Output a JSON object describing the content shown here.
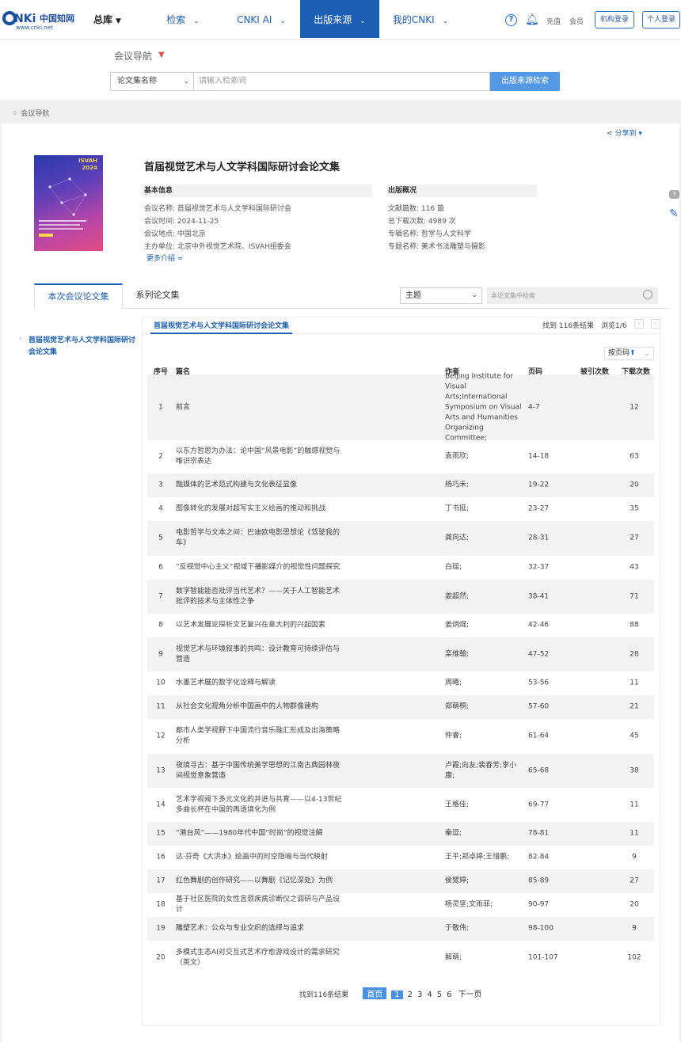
{
  "header": {
    "logo_text": "CNKi中国知网",
    "logo_url": "www.cnki.net",
    "nav": {
      "zongku": "总库",
      "search": "检索",
      "ai": "CNKI AI",
      "source": "出版来源",
      "mycnki": "我的CNKI"
    },
    "recharge": "充值",
    "member": "会员",
    "org_login": "机构登录",
    "personal_login": "个人登录"
  },
  "search": {
    "nav_label": "会议导航",
    "field": "论文集名称",
    "placeholder": "请输入检索词",
    "button": "出版来源检索"
  },
  "breadcrumb": "会议导航",
  "share": "分享到",
  "book": {
    "cover_title": "ISVAH",
    "cover_year": "2024",
    "title": "首届视觉艺术与人文学科国际研讨会论文集",
    "basic_head": "基本信息",
    "basic": [
      {
        "label": "会议名称:",
        "value": "首届视觉艺术与人文学科国际研讨会"
      },
      {
        "label": "会议时间:",
        "value": "2024-11-25"
      },
      {
        "label": "会议地点:",
        "value": "中国北京"
      },
      {
        "label": "主办单位:",
        "value": "北京中外视觉艺术院、ISVAH组委会"
      }
    ],
    "more": "更多介绍",
    "pub_head": "出版概况",
    "pub": [
      {
        "label": "文献篇数:",
        "value": "116 篇"
      },
      {
        "label": "总下载次数:",
        "value": "4989 次"
      },
      {
        "label": "专辑名称:",
        "value": "哲学与人文科学"
      },
      {
        "label": "专题名称:",
        "value": "美术书法雕塑与摄影"
      }
    ]
  },
  "tabs": {
    "current": "本次会议论文集",
    "series": "系列论文集",
    "theme_select": "主题",
    "inner_placeholder": "本论文集中检索"
  },
  "sidebar": {
    "item": "首届视觉艺术与人文学科国际研讨会论文集"
  },
  "list": {
    "sub_tab": "首届视觉艺术与人文学科国际研讨会论文集",
    "found": "找到 116条结果",
    "browse": "浏览1/6",
    "sort": "按页码",
    "headers": {
      "no": "序号",
      "title": "篇名",
      "author": "作者",
      "pages": "页码",
      "cite": "被引次数",
      "download": "下载次数"
    },
    "rows": [
      {
        "no": "1",
        "title": "前言",
        "author": "Beijing Institute for Visual Arts;International Symposium on Visual Arts and Humanities Organizing Committee;",
        "pages": "4-7",
        "cite": "",
        "dl": "12"
      },
      {
        "no": "2",
        "title": "以东方哲思为办法：论中国“风景电影”的触感视觉与唯识宗表达",
        "author": "袁雨欣;",
        "pages": "14-18",
        "cite": "",
        "dl": "63"
      },
      {
        "no": "3",
        "title": "融媒体的艺术范式构建与文化表征显像",
        "author": "杨巧禾;",
        "pages": "19-22",
        "cite": "",
        "dl": "20"
      },
      {
        "no": "4",
        "title": "图像转化的发展对超写实主义绘画的推动和挑战",
        "author": "丁书挺;",
        "pages": "23-27",
        "cite": "",
        "dl": "35"
      },
      {
        "no": "5",
        "title": "电影哲学与文本之间：巴迪欧电影思想论《驾驶我的车》",
        "author": "龚向达;",
        "pages": "28-31",
        "cite": "",
        "dl": "27"
      },
      {
        "no": "6",
        "title": "“反视觉中心主义”视域下播影媒介的视觉性问题探究",
        "author": "白瑶;",
        "pages": "32-37",
        "cite": "",
        "dl": "43"
      },
      {
        "no": "7",
        "title": "数字智能能否批评当代艺术？——关于人工智能艺术批评的技术与主体性之争",
        "author": "姜超然;",
        "pages": "38-41",
        "cite": "",
        "dl": "71"
      },
      {
        "no": "8",
        "title": "以艺术发展论探析文艺复兴在意大利的兴起因素",
        "author": "姜炳焜;",
        "pages": "42-46",
        "cite": "",
        "dl": "88"
      },
      {
        "no": "9",
        "title": "视觉艺术与环境叙事的共鸣：设计教育可持续评估与营造",
        "author": "栾维翰;",
        "pages": "47-52",
        "cite": "",
        "dl": "28"
      },
      {
        "no": "10",
        "title": "水墨艺术展的数字化诠释与解读",
        "author": "周曦;",
        "pages": "53-56",
        "cite": "",
        "dl": "11"
      },
      {
        "no": "11",
        "title": "从社会文化视角分析中国画中的人物群像建构",
        "author": "郑萌桐;",
        "pages": "57-60",
        "cite": "",
        "dl": "21"
      },
      {
        "no": "12",
        "title": "都市人类学视野下中国流行音乐融汇形成及出海策略分析",
        "author": "仲睿;",
        "pages": "61-64",
        "cite": "",
        "dl": "45"
      },
      {
        "no": "13",
        "title": "夜境寻古：基于中国传统美学思想的江南古典园林夜间视觉意象营造",
        "author": "卢霞;向友;裴春芳;李小康;",
        "pages": "65-68",
        "cite": "",
        "dl": "38"
      },
      {
        "no": "14",
        "title": "艺术学视阈下多元文化的并进与共育——以4-13世纪多曲长杯在中国的再语境化为例",
        "author": "王格佳;",
        "pages": "69-77",
        "cite": "",
        "dl": "11"
      },
      {
        "no": "15",
        "title": "“港台风”——1980年代中国“时尚”的视觉注解",
        "author": "秦逗;",
        "pages": "78-81",
        "cite": "",
        "dl": "11"
      },
      {
        "no": "16",
        "title": "达·芬奇《大洪水》绘画中的时空隐喻与当代映射",
        "author": "王平;郑卓婷;王惜鹏;",
        "pages": "82-84",
        "cite": "",
        "dl": "9"
      },
      {
        "no": "17",
        "title": "红色舞剧的创作研究——以舞剧《记忆深处》为例",
        "author": "侯鹭婷;",
        "pages": "85-89",
        "cite": "",
        "dl": "27"
      },
      {
        "no": "18",
        "title": "基于社区医院的女性宫颈疾病诊断仪之调研与产品设计",
        "author": "杨灵坚;文雨菲;",
        "pages": "90-97",
        "cite": "",
        "dl": "20"
      },
      {
        "no": "19",
        "title": "雕塑艺术：公众与专业交织的选择与追求",
        "author": "于敬伟;",
        "pages": "98-100",
        "cite": "",
        "dl": "9"
      },
      {
        "no": "20",
        "title": "多模式生态AI对交互式艺术疗愈游戏设计的需求研究（英文）",
        "author": "解萌;",
        "pages": "101-107",
        "cite": "",
        "dl": "102"
      }
    ]
  },
  "pagination": {
    "found": "找到116条结果",
    "first": "首页",
    "pages": [
      "1",
      "2",
      "3",
      "4",
      "5",
      "6"
    ],
    "next": "下一页"
  }
}
